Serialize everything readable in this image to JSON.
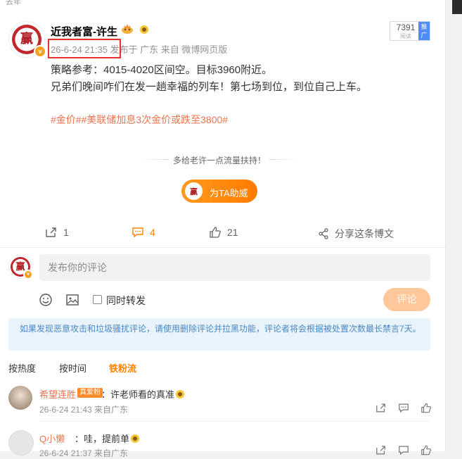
{
  "top_partial_text": "去年",
  "post": {
    "username": "近我者富-许生",
    "meta": "26-6-24 21:35  发布于 广东  来自 微博网页版",
    "reads": "7391",
    "reads_label": "阅读",
    "promote_label": "推广",
    "lines": [
      "策略参考：4015-4020区间空。目标3960附近。",
      "兄弟们晚间咋们在发一趟幸福的列车！第七场到位，到位自己上车。"
    ],
    "tags": "#金价##美联储加息3次金价或跌至3800#",
    "avatar_char": "赢"
  },
  "support": {
    "text": "多给老许一点流量扶持！",
    "button_label": "为TA助威"
  },
  "actions": {
    "repost_count": "1",
    "comment_count": "4",
    "like_count": "21",
    "share_label": "分享这条博文"
  },
  "composer": {
    "placeholder": "发布你的评论",
    "forward_label": "同时转发",
    "submit_label": "评论"
  },
  "notice": "如果发现恶意攻击和垃圾骚扰评论，请使用删除评论并拉黑功能，评论者将会根据被处置次数最长禁言7天。",
  "sort": {
    "hot": "按热度",
    "time": "按时间",
    "fans": "铁粉流"
  },
  "comments": [
    {
      "name": "希望连胜",
      "badge": "真爱粉",
      "text": "：许老师看的真准",
      "meta": "26-6-24 21:43 来自广东"
    },
    {
      "name": "Q小懒",
      "text": "：哇，提前单",
      "meta": "26-6-24 21:37 来自广东"
    }
  ],
  "colors": {
    "accent_orange": "#ff8200",
    "link_orange": "#eb7350",
    "highlight_red": "#e5322d",
    "notice_bg": "#e8f3fc"
  }
}
